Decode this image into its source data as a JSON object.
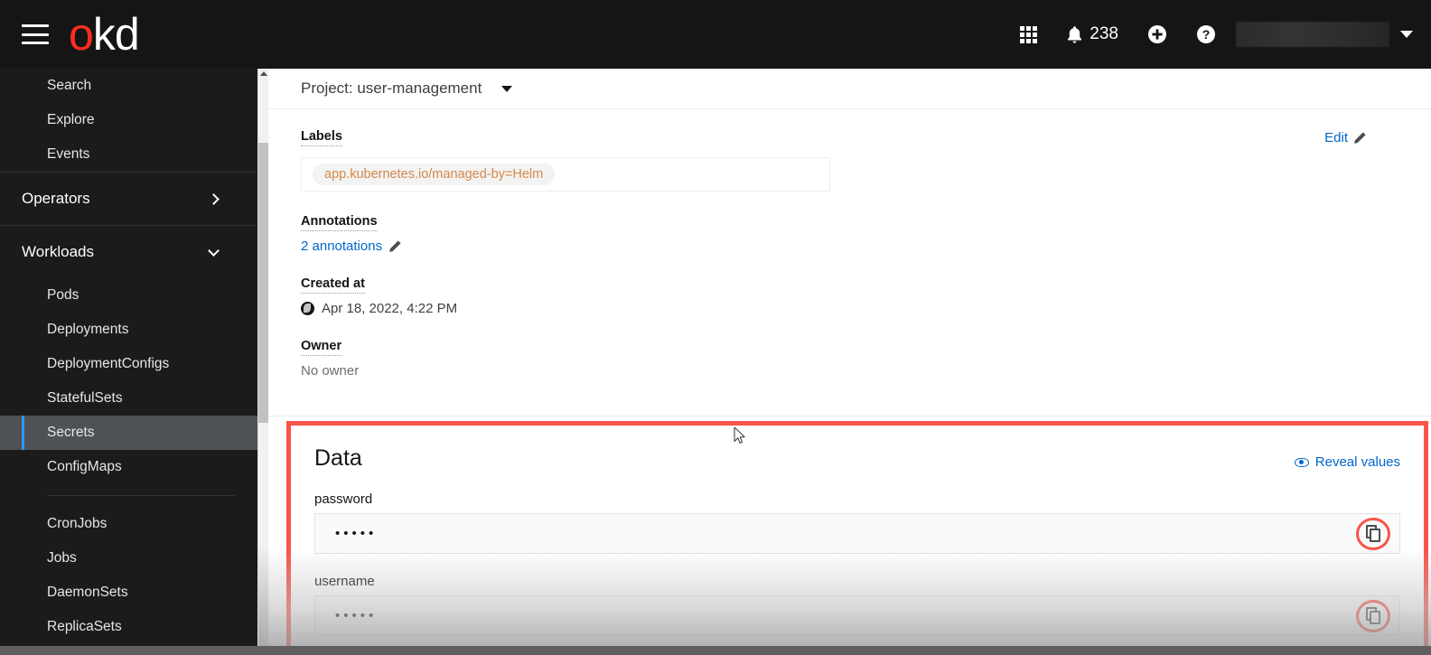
{
  "masthead": {
    "logo_o": "o",
    "logo_kd": "kd",
    "menu_icon": "hamburger-icon",
    "apps_icon": "grid-icon",
    "notification_count": "238",
    "add_icon": "plus-circle-icon",
    "help_icon": "question-circle-icon",
    "user_menu_value": ""
  },
  "sidebar": {
    "items": [
      {
        "label": "Search",
        "type": "link",
        "active": false
      },
      {
        "label": "Explore",
        "type": "link",
        "active": false
      },
      {
        "label": "Events",
        "type": "link",
        "active": false
      },
      {
        "label": "Operators",
        "type": "section",
        "expanded": false
      },
      {
        "label": "Workloads",
        "type": "section",
        "expanded": true
      },
      {
        "label": "Pods",
        "type": "link",
        "active": false
      },
      {
        "label": "Deployments",
        "type": "link",
        "active": false
      },
      {
        "label": "DeploymentConfigs",
        "type": "link",
        "active": false
      },
      {
        "label": "StatefulSets",
        "type": "link",
        "active": false
      },
      {
        "label": "Secrets",
        "type": "link",
        "active": true
      },
      {
        "label": "ConfigMaps",
        "type": "link",
        "active": false
      },
      {
        "label": "CronJobs",
        "type": "link",
        "active": false
      },
      {
        "label": "Jobs",
        "type": "link",
        "active": false
      },
      {
        "label": "DaemonSets",
        "type": "link",
        "active": false
      },
      {
        "label": "ReplicaSets",
        "type": "link",
        "active": false
      }
    ]
  },
  "project_bar": {
    "text": "Project: user-management",
    "caret_icon": "caret-down-icon"
  },
  "details": {
    "labels_heading": "Labels",
    "edit_label": "Edit",
    "edit_icon": "pencil-icon",
    "label_chips": [
      "app.kubernetes.io/managed-by=Helm"
    ],
    "annotations_heading": "Annotations",
    "annotations_link": "2 annotations",
    "annotations_icon": "pencil-icon",
    "created_heading": "Created at",
    "created_icon": "globe-icon",
    "created_value": "Apr 18, 2022, 4:22 PM",
    "owner_heading": "Owner",
    "owner_value": "No owner"
  },
  "data_card": {
    "title": "Data",
    "reveal_label": "Reveal values",
    "reveal_icon": "eye-icon",
    "entries": [
      {
        "key": "password",
        "value": "•••••",
        "copy_icon": "copy-icon"
      },
      {
        "key": "username",
        "value": "•••••",
        "copy_icon": "copy-icon"
      }
    ]
  },
  "colors": {
    "brand_red": "#ff2d20",
    "annotation_red": "#f8544b",
    "link_blue": "#0066cc",
    "active_accent": "#2b9af3",
    "label_chip_text": "#d4884a",
    "masthead_bg": "#151515",
    "sidebar_bg": "#1b1b1b"
  }
}
